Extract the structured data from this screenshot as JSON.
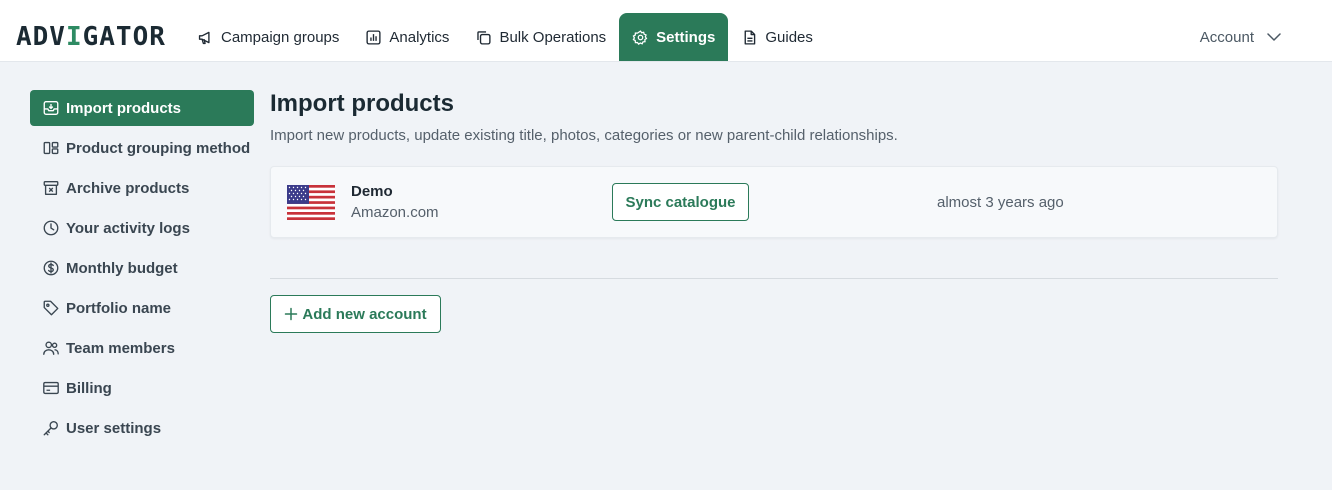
{
  "logo": {
    "part1": "ADV",
    "part2": "I",
    "part3": "GATOR"
  },
  "nav": {
    "items": [
      {
        "label": "Campaign groups",
        "icon": "megaphone-icon"
      },
      {
        "label": "Analytics",
        "icon": "bar-chart-icon"
      },
      {
        "label": "Bulk Operations",
        "icon": "copy-icon"
      },
      {
        "label": "Settings",
        "icon": "gear-icon",
        "active": true
      },
      {
        "label": "Guides",
        "icon": "document-icon"
      }
    ],
    "account_label": "Account"
  },
  "sidebar": {
    "items": [
      {
        "label": "Import products",
        "icon": "inbox-icon",
        "active": true
      },
      {
        "label": "Product grouping method",
        "icon": "grouping-icon"
      },
      {
        "label": "Archive products",
        "icon": "archive-icon"
      },
      {
        "label": "Your activity logs",
        "icon": "clock-icon"
      },
      {
        "label": "Monthly budget",
        "icon": "dollar-icon"
      },
      {
        "label": "Portfolio name",
        "icon": "tag-icon"
      },
      {
        "label": "Team members",
        "icon": "users-icon"
      },
      {
        "label": "Billing",
        "icon": "credit-card-icon"
      },
      {
        "label": "User settings",
        "icon": "key-icon"
      }
    ]
  },
  "main": {
    "title": "Import products",
    "subtitle": "Import new products, update existing title, photos, categories or new parent-child relationships.",
    "accounts": [
      {
        "name": "Demo",
        "marketplace": "Amazon.com",
        "flag": "us-flag-icon",
        "sync_label": "Sync catalogue",
        "last_sync": "almost 3 years ago"
      }
    ],
    "add_account_label": "Add new account"
  },
  "colors": {
    "brand": "#2b7a59",
    "logo_accent": "#2e8b63",
    "background": "#f0f3f7"
  }
}
